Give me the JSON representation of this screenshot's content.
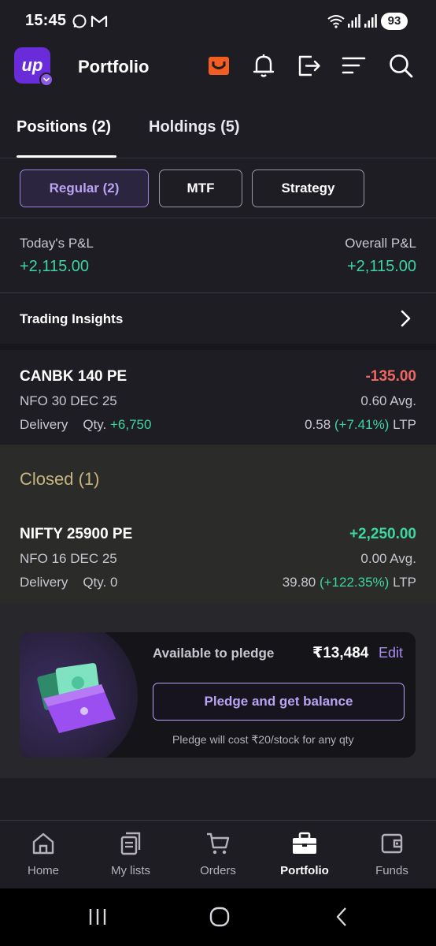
{
  "status_bar": {
    "time": "15:45",
    "battery": "93"
  },
  "header": {
    "logo_text": "up",
    "title": "Portfolio"
  },
  "tabs": [
    {
      "label": "Positions (2)",
      "active": true
    },
    {
      "label": "Holdings (5)",
      "active": false
    }
  ],
  "filters": [
    {
      "label": "Regular (2)",
      "active": true
    },
    {
      "label": "MTF",
      "active": false
    },
    {
      "label": "Strategy",
      "active": false
    }
  ],
  "pnl": {
    "today_label": "Today's P&L",
    "today_value": "+2,115.00",
    "overall_label": "Overall P&L",
    "overall_value": "+2,115.00"
  },
  "insights": {
    "label": "Trading Insights"
  },
  "positions": [
    {
      "name": "CANBK 140 PE",
      "pnl": "-135.00",
      "exchange": "NFO 30 DEC 25",
      "avg": "0.60 Avg.",
      "product": "Delivery",
      "qty_label": "Qty.",
      "qty": "+6,750",
      "ltp": "0.58",
      "ltp_change": "(+7.41%)",
      "ltp_label": "LTP"
    }
  ],
  "closed": {
    "title": "Closed (1)",
    "items": [
      {
        "name": "NIFTY 25900 PE",
        "pnl": "+2,250.00",
        "exchange": "NFO 16 DEC 25",
        "avg": "0.00 Avg.",
        "product": "Delivery",
        "qty_label": "Qty.",
        "qty": "0",
        "ltp": "39.80",
        "ltp_change": "(+122.35%)",
        "ltp_label": "LTP"
      }
    ]
  },
  "pledge": {
    "label": "Available to pledge",
    "amount": "₹13,484",
    "edit": "Edit",
    "button": "Pledge and get balance",
    "note": "Pledge will cost ₹20/stock for any qty"
  },
  "bottom_nav": [
    {
      "label": "Home",
      "icon": "home-icon"
    },
    {
      "label": "My lists",
      "icon": "lists-icon"
    },
    {
      "label": "Orders",
      "icon": "cart-icon"
    },
    {
      "label": "Portfolio",
      "icon": "briefcase-icon",
      "active": true
    },
    {
      "label": "Funds",
      "icon": "wallet-icon"
    }
  ],
  "colors": {
    "background": "#1f1d24",
    "accent": "#b9a4f1",
    "positive": "#3dd6a0",
    "negative": "#f06762",
    "closed_title": "#c7b57e"
  }
}
